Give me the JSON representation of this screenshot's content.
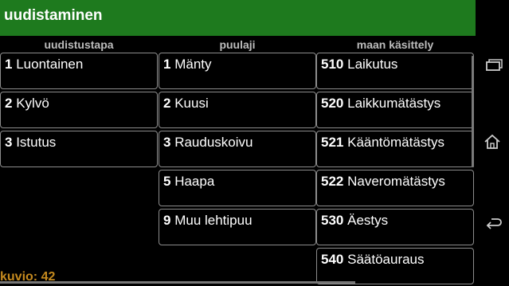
{
  "header": {
    "title": "uudistaminen"
  },
  "columns": [
    {
      "header": "uudistustapa",
      "items": [
        {
          "code": "1",
          "label": "Luontainen"
        },
        {
          "code": "2",
          "label": "Kylvö"
        },
        {
          "code": "3",
          "label": "Istutus"
        }
      ]
    },
    {
      "header": "puulaji",
      "items": [
        {
          "code": "1",
          "label": "Mänty"
        },
        {
          "code": "2",
          "label": "Kuusi"
        },
        {
          "code": "3",
          "label": "Rauduskoivu"
        },
        {
          "code": "5",
          "label": "Haapa"
        },
        {
          "code": "9",
          "label": "Muu lehtipuu"
        }
      ]
    },
    {
      "header": "maan käsittely",
      "items": [
        {
          "code": "510",
          "label": "Laikutus"
        },
        {
          "code": "520",
          "label": "Laikkumätästys"
        },
        {
          "code": "521",
          "label": "Kääntömätästys"
        },
        {
          "code": "522",
          "label": "Naveromätästys"
        },
        {
          "code": "530",
          "label": "Äestys"
        },
        {
          "code": "540",
          "label": "Säätöauraus"
        }
      ]
    }
  ],
  "status": {
    "text": "kuvio: 42"
  },
  "navbar": {
    "icons": [
      "recent-apps-icon",
      "home-icon",
      "back-icon"
    ]
  },
  "colors": {
    "titlebar": "#1e7a1e",
    "status": "#c58a1e",
    "header_text": "#bdbdbd"
  }
}
